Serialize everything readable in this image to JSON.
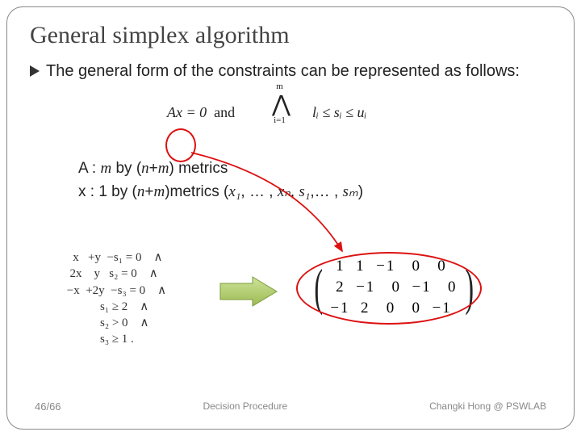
{
  "title": "General simplex algorithm",
  "bullet": "The general form of the constraints can be represented as follows:",
  "formula": {
    "ax": "Ax = 0",
    "and": "and",
    "bigand_top": "m",
    "bigand_sym": "⋀",
    "bigand_bot": "i=1",
    "bound": "lᵢ ≤ sᵢ ≤ uᵢ"
  },
  "desc": {
    "line1_pre": "A : ",
    "line1_m": "m",
    "line1_mid": " by (",
    "line1_n": "n",
    "line1_p": "+",
    "line1_m2": "m",
    "line1_post": ") metrics",
    "line2_pre": "x : 1 by (",
    "line2_n": "n",
    "line2_p": "+",
    "line2_m": "m",
    "line2_mid": ")metrics (",
    "line2_x1": "x₁",
    "line2_c1": ", … , ",
    "line2_xn": "xₙ",
    "line2_c2": ", ",
    "line2_s1": "s₁",
    "line2_c3": ",… , ",
    "line2_sm": "sₘ",
    "line2_close": ")"
  },
  "equations": [
    "   x   +y  −s₁ = 0    ∧",
    "  2x    y   s₂ = 0    ∧",
    " −x  +2y  −s₃ = 0    ∧",
    "            s₁ ≥ 2    ∧",
    "            s₂ > 0    ∧",
    "            s₃ ≥ 1 ."
  ],
  "matrix": {
    "rows": [
      " 1  1  −1   0   0",
      " 2  −1   0  −1   0",
      "−1  2   0   0  −1"
    ]
  },
  "footer": {
    "left": "46/66",
    "center": "Decision Procedure",
    "right": "Changki Hong @ PSWLAB"
  }
}
